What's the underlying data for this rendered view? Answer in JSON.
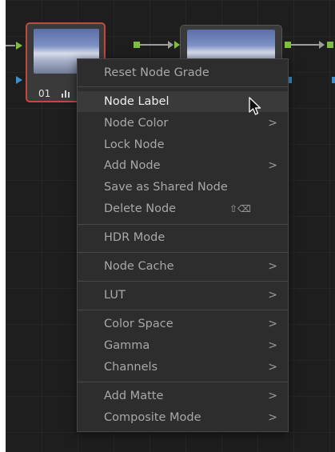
{
  "nodes": [
    {
      "number": "01",
      "selected": true,
      "border_color": "#c14a3d"
    },
    {
      "number": "",
      "selected": false
    }
  ],
  "context_menu": {
    "items": [
      {
        "label": "Reset Node Grade",
        "submenu": false
      },
      {
        "label": "Node Label",
        "submenu": false,
        "highlighted": true
      },
      {
        "label": "Node Color",
        "submenu": true
      },
      {
        "label": "Lock Node",
        "submenu": false
      },
      {
        "label": "Add Node",
        "submenu": true
      },
      {
        "label": "Save as Shared Node",
        "submenu": false
      },
      {
        "label": "Delete Node",
        "submenu": false,
        "shortcut": "⇧⌫"
      },
      {
        "label": "HDR Mode",
        "submenu": false
      },
      {
        "label": "Node Cache",
        "submenu": true
      },
      {
        "label": "LUT",
        "submenu": true
      },
      {
        "label": "Color Space",
        "submenu": true
      },
      {
        "label": "Gamma",
        "submenu": true
      },
      {
        "label": "Channels",
        "submenu": true
      },
      {
        "label": "Add Matte",
        "submenu": true
      },
      {
        "label": "Composite Mode",
        "submenu": true
      }
    ],
    "submenu_glyph": ">"
  },
  "colors": {
    "canvas_bg": "#1e1e1e",
    "menu_bg": "#2d2d2d",
    "highlight_bg": "#3a3a3a",
    "rgb_port": "#7fbf3f",
    "key_port": "#3a8fd0",
    "selected_border": "#c14a3d"
  }
}
